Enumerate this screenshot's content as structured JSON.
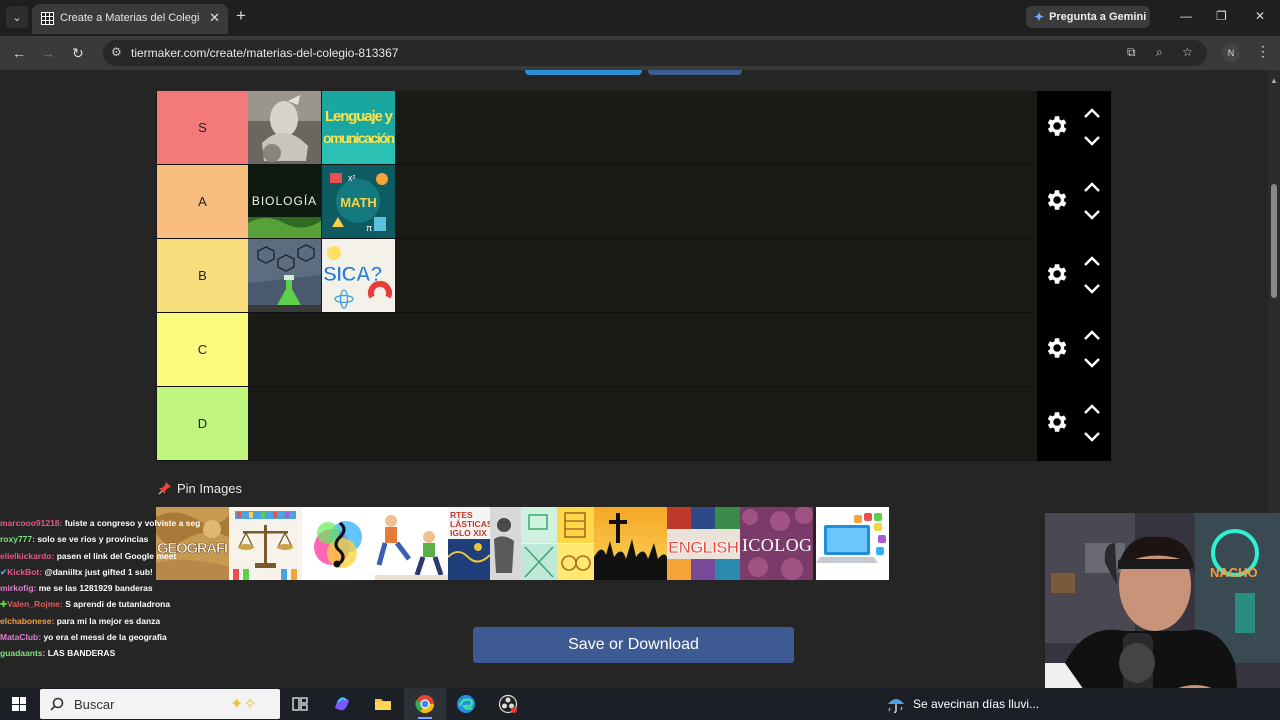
{
  "browser": {
    "tab_title": "Create a Materias del Colegio. T",
    "gemini_label": "Pregunta a Gemini",
    "url": "tiermaker.com/create/materias-del-colegio-813367",
    "profile_initial": "N"
  },
  "tiers": [
    {
      "label": "S",
      "color": "#f47a7a"
    },
    {
      "label": "A",
      "color": "#f8bd7f"
    },
    {
      "label": "B",
      "color": "#f7dd7c"
    },
    {
      "label": "C",
      "color": "#fafb7f"
    },
    {
      "label": "D",
      "color": "#c0f67f"
    }
  ],
  "tier_images": {
    "s2": "Lenguaje y Comunicación",
    "a1": "BIOLOGÍA",
    "a2": "MATH",
    "b2": "SICA?"
  },
  "pin_label": "Pin Images",
  "pool_labels": {
    "geografia": "GEOGRAFI",
    "artes": "RTES LÁSTICAS IGLO XIX",
    "english": "ENGLISH",
    "psicologia": "ICOLOG"
  },
  "save_button": "Save or Download",
  "chat": [
    {
      "user": "marcooo91218:",
      "color": "#e05a8a",
      "text": " fuiste a congreso y volviste a seguir con el stream"
    },
    {
      "user": "roxy777:",
      "color": "#7fe07f",
      "text": " solo se ve rios y provincias"
    },
    {
      "user": "elielkickardo:",
      "color": "#e05a8a",
      "text": " pasen el link del Google meet"
    },
    {
      "user": "KickBot:",
      "color": "#e05a8a",
      "text": " @daniiltx just gifted 1 sub!"
    },
    {
      "user": "mirkofig:",
      "color": "#e07fd0",
      "text": " me se las 1281929 banderas"
    },
    {
      "user": "Valen_Rojme:",
      "color": "#e05a5a",
      "text": " S aprendi de tutanladrona"
    },
    {
      "user": "elchabonese:",
      "color": "#f0a040",
      "text": " para mi la mejor es danza"
    },
    {
      "user": "MataClub:",
      "color": "#e07fd0",
      "text": " yo era el messi de la geografia"
    },
    {
      "user": "guadaants:",
      "color": "#7fe07f",
      "text": " LAS BANDERAS"
    }
  ],
  "taskbar": {
    "search_placeholder": "Buscar",
    "weather": "Se avecinan días lluvi..."
  }
}
